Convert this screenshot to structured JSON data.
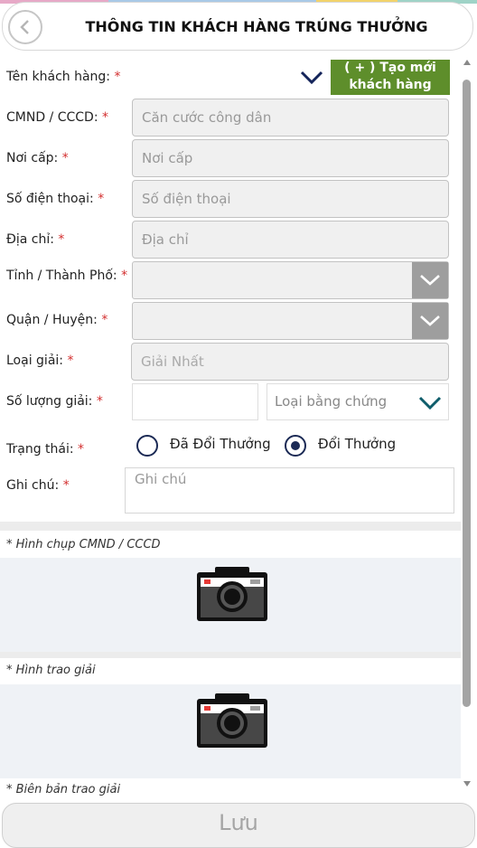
{
  "colors": {
    "accent_green": "#5e8e2b",
    "radio_navy": "#1b2a55",
    "required_red": "#d32f2f",
    "select_button_gray": "#9e9e9e"
  },
  "header": {
    "title": "THÔNG TIN KHÁCH HÀNG TRÚNG THƯỞNG",
    "back_icon": "chevron-left-icon"
  },
  "form": {
    "customer_name": {
      "label": "Tên khách hàng:",
      "value": "",
      "create_button": "( + ) Tạo mới khách hàng"
    },
    "id_number": {
      "label": "CMND / CCCD:",
      "placeholder": "Căn cước công dân"
    },
    "issue_place": {
      "label": "Nơi cấp:",
      "placeholder": "Nơi cấp"
    },
    "phone": {
      "label": "Số điện thoại:",
      "placeholder": "Số điện thoại"
    },
    "address": {
      "label": "Địa chỉ:",
      "placeholder": "Địa chỉ"
    },
    "province": {
      "label": "Tỉnh / Thành Phố:",
      "value": ""
    },
    "district": {
      "label": "Quận / Huyện:",
      "value": ""
    },
    "prize_type": {
      "label": "Loại giải:",
      "value": "Giải Nhất"
    },
    "prize_quantity": {
      "label": "Số lượng giải:",
      "value": "",
      "evidence_placeholder": "Loại bằng chứng"
    },
    "status": {
      "label": "Trạng thái:",
      "options": [
        "Đã Đổi Thưởng",
        "Đổi Thưởng"
      ],
      "selected": "Đổi Thưởng"
    },
    "note": {
      "label": "Ghi chú:",
      "placeholder": "Ghi chú"
    },
    "required_mark": "*"
  },
  "sections": [
    {
      "title": "* Hình chụp CMND / CCCD",
      "icon": "camera-icon"
    },
    {
      "title": "* Hình trao giải",
      "icon": "camera-icon"
    },
    {
      "title": "* Biên bản trao giải"
    }
  ],
  "footer": {
    "save_label": "Lưu"
  }
}
